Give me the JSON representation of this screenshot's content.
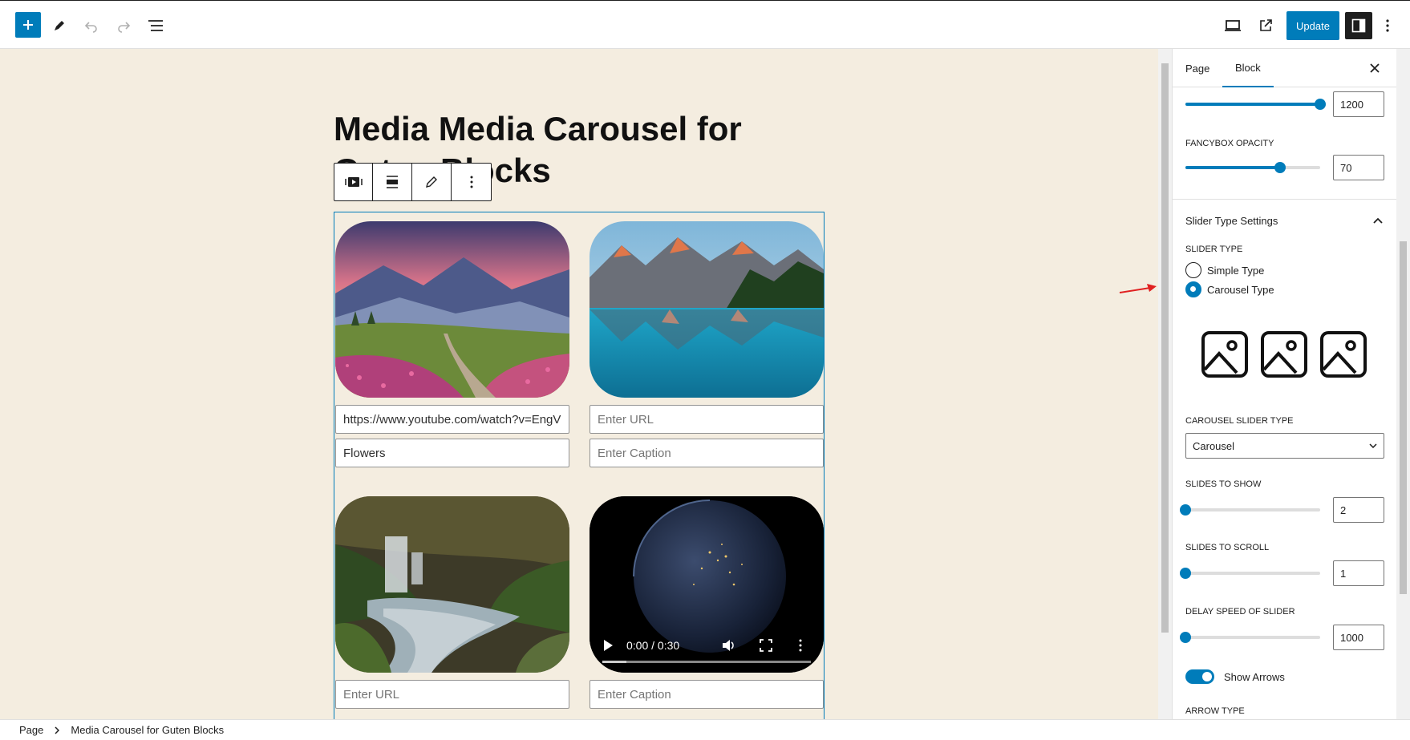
{
  "toolbar": {
    "add_icon": "plus-icon",
    "update_label": "Update"
  },
  "canvas": {
    "page_title": "Media Media Carousel for Guten Blocks",
    "items": [
      {
        "image": "mountain-flowers-landscape",
        "url_value": "https://www.youtube.com/watch?v=EngV",
        "url_placeholder": "Enter URL",
        "caption_value": "Flowers",
        "caption_placeholder": "Enter Caption"
      },
      {
        "image": "mountain-lake-landscape",
        "url_value": "",
        "url_placeholder": "Enter URL",
        "caption_value": "",
        "caption_placeholder": "Enter Caption"
      },
      {
        "image": "forest-waterfall",
        "url_value": "",
        "url_placeholder": "Enter URL",
        "caption_value": "",
        "caption_placeholder": "Enter Caption"
      },
      {
        "image": "earth-at-night-video",
        "video_time": "0:00 / 0:30",
        "url_value": "",
        "url_placeholder": "Enter URL",
        "caption_value": "",
        "caption_placeholder": "Enter Caption"
      }
    ]
  },
  "sidebar": {
    "tab_page": "Page",
    "tab_block": "Block",
    "fancybox_width_value": "1200",
    "fancybox_width_fraction": 1.0,
    "fancybox_opacity_label": "FANCYBOX OPACITY",
    "fancybox_opacity_value": "70",
    "fancybox_opacity_fraction": 0.7,
    "slider_section_title": "Slider Type Settings",
    "slider_type_label": "SLIDER TYPE",
    "slider_type_options": [
      "Simple Type",
      "Carousel Type"
    ],
    "slider_type_selected": "Carousel Type",
    "carousel_slider_type_label": "CAROUSEL SLIDER TYPE",
    "carousel_slider_type_value": "Carousel",
    "slides_to_show_label": "SLIDES TO SHOW",
    "slides_to_show_value": "2",
    "slides_to_scroll_label": "SLIDES TO SCROLL",
    "slides_to_scroll_value": "1",
    "delay_speed_label": "DELAY SPEED OF SLIDER",
    "delay_speed_value": "1000",
    "show_arrows_label": "Show Arrows",
    "show_arrows_on": true,
    "arrow_type_label": "ARROW TYPE"
  },
  "breadcrumb": {
    "root": "Page",
    "current": "Media Carousel for Guten Blocks"
  },
  "colors": {
    "accent": "#007cba",
    "canvas_bg": "#f4ede0"
  }
}
